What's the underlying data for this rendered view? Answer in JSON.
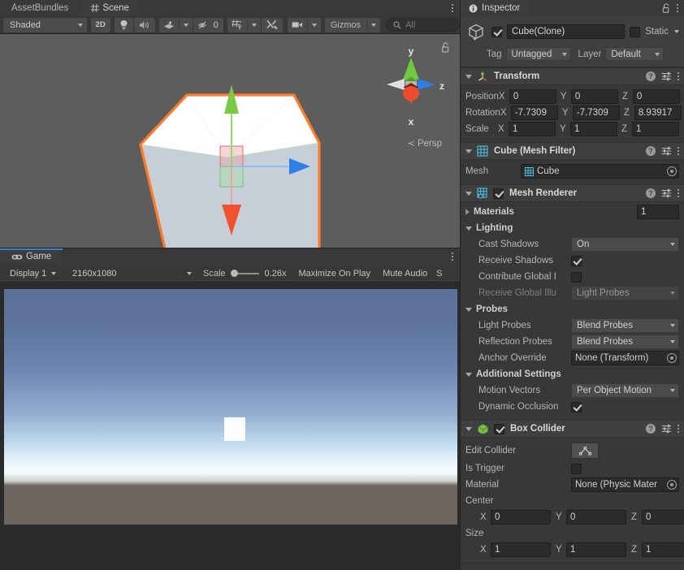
{
  "scene_panel": {
    "tabs": [
      {
        "label": "AssetBundles",
        "icon": "",
        "active": false
      },
      {
        "label": "Scene",
        "icon": "grid-icon",
        "active": true
      }
    ],
    "toolbar": {
      "shading_mode": "Shaded",
      "mode_2d": "2D",
      "hidden_count": "0",
      "gizmos_label": "Gizmos",
      "search_placeholder": "All",
      "icons": [
        "lighting-icon",
        "audio-icon",
        "fx-icon",
        "hidden-objects-icon",
        "grid-icon",
        "tools-icon",
        "camera-icon"
      ]
    },
    "gizmo": {
      "axis_y": "y",
      "axis_x": "x",
      "axis_z": "z",
      "projection": "Persp",
      "color_x": "#e8502d",
      "color_y": "#7ac943",
      "color_z": "#2f7fe8"
    },
    "selection_outline_color": "#ff7b28"
  },
  "game_panel": {
    "tabs": [
      {
        "label": "Game",
        "icon": "gamepad-icon",
        "active": true
      }
    ],
    "toolbar": {
      "display": "Display 1",
      "resolution": "2160x1080",
      "scale_label": "Scale",
      "scale_value": "0.26x",
      "maximize_on_play": "Maximize On Play",
      "mute_audio": "Mute Audio",
      "stats": "S"
    }
  },
  "inspector": {
    "tab_label": "Inspector",
    "object": {
      "enabled": true,
      "name": "Cube(Clone)",
      "static_label": "Static",
      "static_checked": false,
      "tag_label": "Tag",
      "tag_value": "Untagged",
      "layer_label": "Layer",
      "layer_value": "Default"
    },
    "components": [
      {
        "title": "Transform",
        "icon": "transform-icon",
        "expanded": true,
        "has_checkbox": false,
        "rows": [
          {
            "label": "Position",
            "x": "0",
            "y": "0",
            "z": "0"
          },
          {
            "label": "Rotation",
            "x": "-7.7309",
            "y": "-7.7309",
            "z": "8.93917"
          },
          {
            "label": "Scale",
            "x": "1",
            "y": "1",
            "z": "1"
          }
        ]
      },
      {
        "title": "Cube (Mesh Filter)",
        "icon": "mesh-filter-icon",
        "expanded": true,
        "has_checkbox": false,
        "mesh_label": "Mesh",
        "mesh_value": "Cube"
      },
      {
        "title": "Mesh Renderer",
        "icon": "mesh-renderer-icon",
        "expanded": true,
        "has_checkbox": true,
        "checked": true,
        "materials_label": "Materials",
        "materials_count": "1",
        "lighting_label": "Lighting",
        "cast_shadows_label": "Cast Shadows",
        "cast_shadows_value": "On",
        "receive_shadows_label": "Receive Shadows",
        "receive_shadows_checked": true,
        "contribute_gi_label": "Contribute Global I",
        "contribute_gi_checked": false,
        "receive_gi_label": "Receive Global Illu",
        "receive_gi_value": "Light Probes",
        "probes_label": "Probes",
        "light_probes_label": "Light Probes",
        "light_probes_value": "Blend Probes",
        "reflection_probes_label": "Reflection Probes",
        "reflection_probes_value": "Blend Probes",
        "anchor_override_label": "Anchor Override",
        "anchor_override_value": "None (Transform)",
        "additional_settings_label": "Additional Settings",
        "motion_vectors_label": "Motion Vectors",
        "motion_vectors_value": "Per Object Motion",
        "dynamic_occlusion_label": "Dynamic Occlusion",
        "dynamic_occlusion_checked": true
      },
      {
        "title": "Box Collider",
        "icon": "box-collider-icon",
        "expanded": true,
        "has_checkbox": true,
        "checked": true,
        "edit_collider_label": "Edit Collider",
        "is_trigger_label": "Is Trigger",
        "is_trigger_checked": false,
        "material_label": "Material",
        "material_value": "None (Physic Mater",
        "center_label": "Center",
        "center": {
          "x": "0",
          "y": "0",
          "z": "0"
        },
        "size_label": "Size",
        "size": {
          "x": "1",
          "y": "1",
          "z": "1"
        }
      }
    ]
  }
}
